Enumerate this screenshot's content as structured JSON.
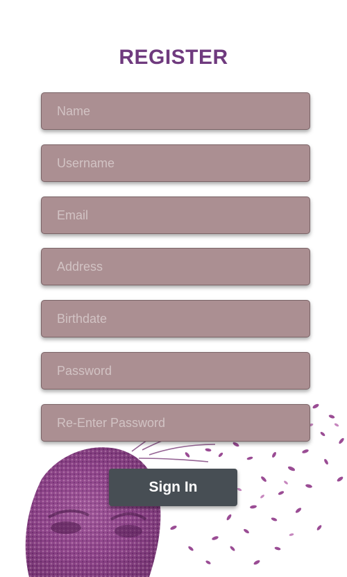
{
  "page": {
    "title": "REGISTER"
  },
  "form": {
    "fields": [
      {
        "id": "name",
        "placeholder": "Name",
        "value": ""
      },
      {
        "id": "username",
        "placeholder": "Username",
        "value": ""
      },
      {
        "id": "email",
        "placeholder": "Email",
        "value": ""
      },
      {
        "id": "address",
        "placeholder": "Address",
        "value": ""
      },
      {
        "id": "birthdate",
        "placeholder": "Birthdate",
        "value": ""
      },
      {
        "id": "password",
        "placeholder": "Password",
        "value": ""
      },
      {
        "id": "repassword",
        "placeholder": "Re-Enter Password",
        "value": ""
      }
    ],
    "submit_label": "Sign In"
  },
  "colors": {
    "title": "#6f3a7e",
    "field_bg": "#ab8f92",
    "field_placeholder": "#d2c3c4",
    "button_bg": "#474e54",
    "button_text": "#ffffff",
    "page_bg": "#ffffff",
    "art_purple": "#8a3f86"
  },
  "decor": {
    "background_icon": "petal-face-art-icon"
  }
}
